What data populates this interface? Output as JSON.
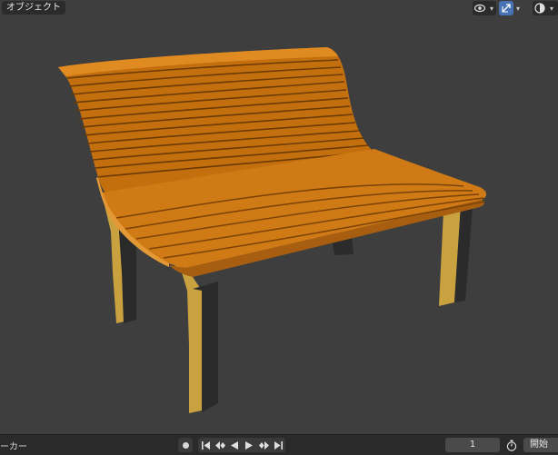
{
  "header": {
    "mode_label": "オブジェクト"
  },
  "viewport_icons": [
    "eye-icon",
    "gizmo-icon",
    "shading-icon",
    "chevron-down-icon"
  ],
  "timeline": {
    "marker_label": "ーカー",
    "current_frame": "1",
    "start_label": "開始"
  },
  "colors": {
    "viewport_bg": "#3e3e3e",
    "bench_wood": "#d07a16",
    "bench_leg": "#c8a040",
    "accent_blue": "#4772b3"
  }
}
